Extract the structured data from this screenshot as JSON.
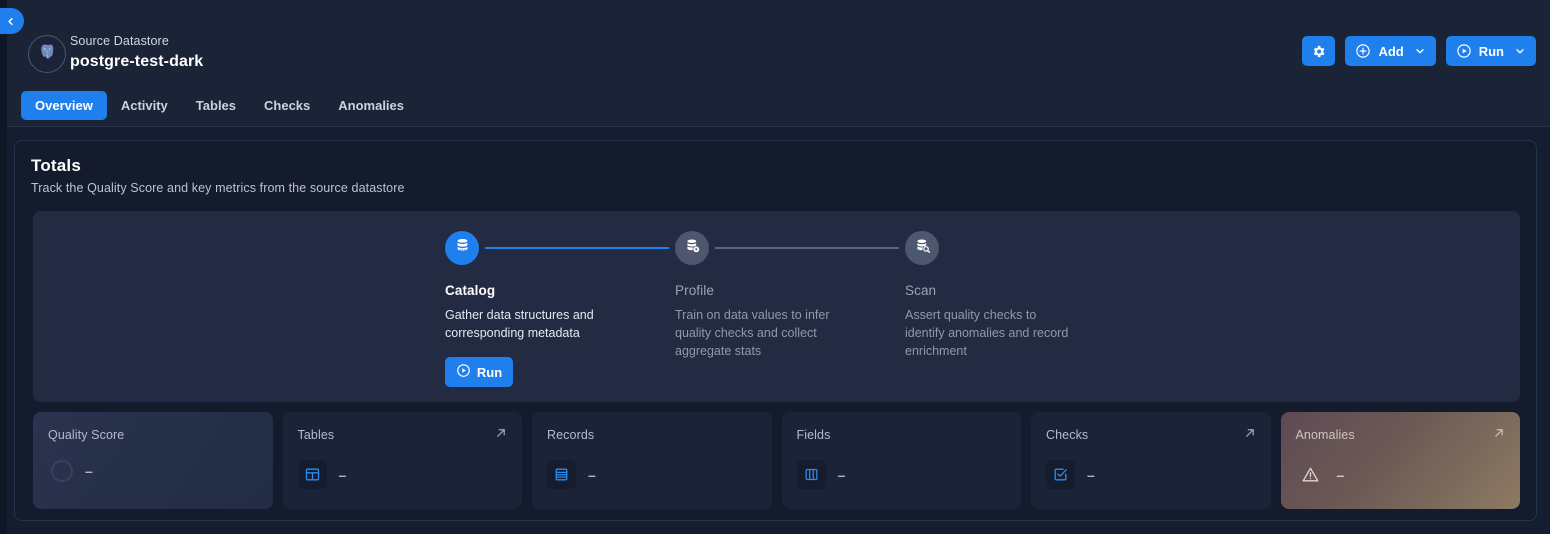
{
  "header": {
    "back_icon": "chevron-left-icon",
    "datastore_logo_icon": "postgresql-elephant-icon",
    "subtitle": "Source Datastore",
    "title": "postgre-test-dark",
    "tabs": [
      {
        "label": "Overview",
        "active": true
      },
      {
        "label": "Activity",
        "active": false
      },
      {
        "label": "Tables",
        "active": false
      },
      {
        "label": "Checks",
        "active": false
      },
      {
        "label": "Anomalies",
        "active": false
      }
    ],
    "actions": {
      "settings_icon": "gear-icon",
      "add_label": "Add",
      "add_icon": "plus-circle-icon",
      "run_label": "Run",
      "run_icon": "play-circle-icon",
      "caret_icon": "chevron-down-icon"
    }
  },
  "totals": {
    "title": "Totals",
    "subtitle": "Track the Quality Score and key metrics from the source datastore"
  },
  "steps": [
    {
      "name": "Catalog",
      "description": "Gather data structures and corresponding metadata",
      "icon": "database-icon",
      "state": "active",
      "connector": "active",
      "run_label": "Run"
    },
    {
      "name": "Profile",
      "description": "Train on data values to infer quality checks and collect aggregate stats",
      "icon": "database-gear-icon",
      "state": "idle",
      "connector": "idle"
    },
    {
      "name": "Scan",
      "description": "Assert quality checks to identify anomalies and record enrichment",
      "icon": "database-search-icon",
      "state": "idle",
      "connector": "none"
    }
  ],
  "metrics": [
    {
      "label": "Quality Score",
      "value": "–",
      "icon": "score-ring-icon",
      "arrow": false,
      "variant": "quality"
    },
    {
      "label": "Tables",
      "value": "–",
      "icon": "table-icon",
      "arrow": true,
      "variant": "default"
    },
    {
      "label": "Records",
      "value": "–",
      "icon": "records-icon",
      "arrow": false,
      "variant": "default"
    },
    {
      "label": "Fields",
      "value": "–",
      "icon": "columns-icon",
      "arrow": false,
      "variant": "default"
    },
    {
      "label": "Checks",
      "value": "–",
      "icon": "check-square-icon",
      "arrow": true,
      "variant": "default"
    },
    {
      "label": "Anomalies",
      "value": "–",
      "icon": "warning-triangle-icon",
      "arrow": true,
      "variant": "anomalies"
    }
  ],
  "colors": {
    "accent": "#1e7fed",
    "page_bg": "#151d30",
    "header_bg": "#1b2336",
    "card_bg": "#141b2d",
    "panel_bg": "#222b42",
    "metric_bg": "#1b2338"
  }
}
